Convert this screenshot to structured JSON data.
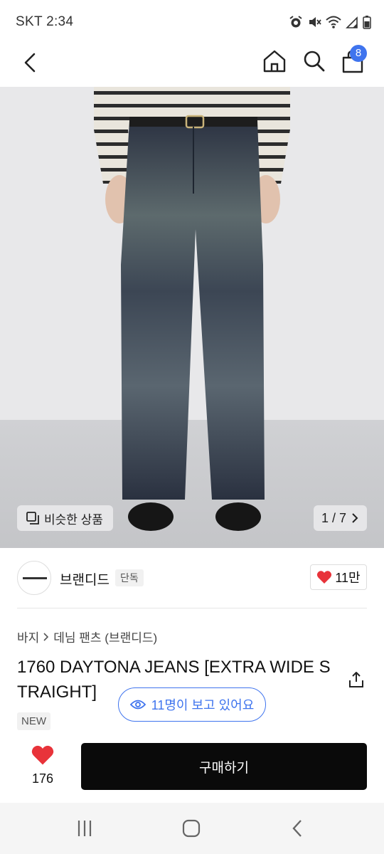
{
  "status_bar": {
    "time": "SKT 2:34",
    "icons": [
      "alarm-icon",
      "mute-icon",
      "wifi-icon",
      "signal-icon",
      "battery-icon"
    ]
  },
  "app_bar": {
    "cart_count": "8",
    "icons": [
      "back-icon",
      "home-icon",
      "search-icon",
      "shopping-bag-icon"
    ]
  },
  "hero": {
    "similar_label": "비슷한 상품",
    "page_indicator": "1 / 7"
  },
  "brand": {
    "name": "브랜디드",
    "tag": "단독",
    "likes": "11만"
  },
  "product": {
    "breadcrumb": [
      "바지",
      "데님 팬츠 (브랜디드)"
    ],
    "title": "1760 DAYTONA JEANS [EXTRA WIDE STRAIGHT]",
    "badge": "NEW",
    "viewers": "11명이 보고 있어요"
  },
  "actions": {
    "wish_count": "176",
    "buy_label": "구매하기"
  },
  "colors": {
    "accent": "#3f74ee",
    "heart": "#e8333a",
    "buy_button": "#0a0a0a"
  }
}
